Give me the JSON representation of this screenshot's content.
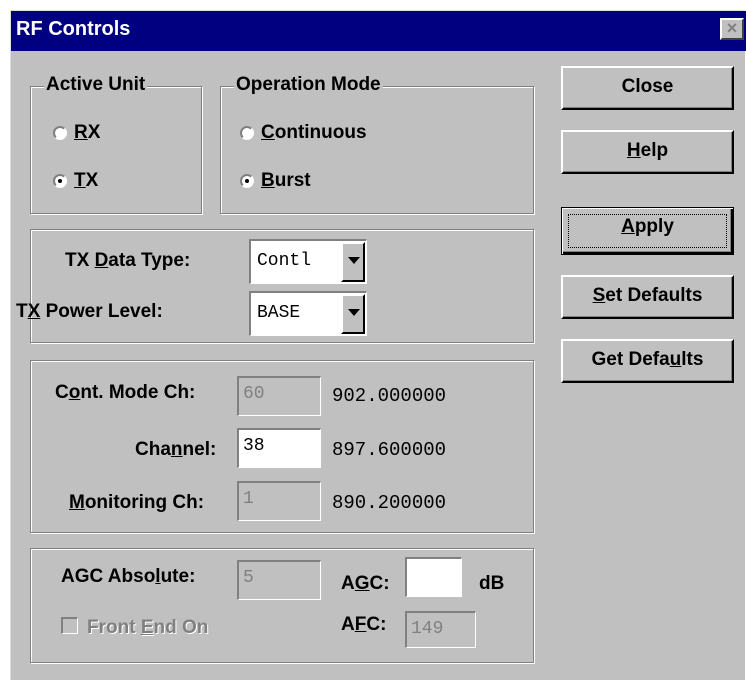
{
  "window": {
    "title": "RF Controls",
    "close_glyph": "×"
  },
  "active_unit": {
    "legend": "Active Unit",
    "rx_label": "RX",
    "tx_label": "TX",
    "selected": "TX"
  },
  "operation_mode": {
    "legend": "Operation Mode",
    "continuous_label": "Continuous",
    "burst_label": "Burst",
    "selected": "Burst"
  },
  "tx": {
    "data_type_label": "TX Data Type:",
    "data_type_value": "Contl",
    "power_level_label": "TX Power Level:",
    "power_level_value": "BASE"
  },
  "channels": {
    "cont_mode_label": "Cont. Mode Ch:",
    "cont_mode_value": "60",
    "cont_mode_freq": "902.000000",
    "channel_label": "Channel:",
    "channel_value": "38",
    "channel_freq": "897.600000",
    "monitoring_label": "Monitoring Ch:",
    "monitoring_value": "1",
    "monitoring_freq": "890.200000"
  },
  "agc": {
    "absolute_label": "AGC Absolute:",
    "absolute_value": "5",
    "agc_label": "AGC:",
    "agc_value": "",
    "agc_unit": "dB",
    "afc_label": "AFC:",
    "afc_value": "149",
    "front_end_label": "Front End On"
  },
  "buttons": {
    "close": "Close",
    "help": "Help",
    "apply": "Apply",
    "set_defaults": "Set Defaults",
    "get_defaults": "Get Defaults"
  }
}
